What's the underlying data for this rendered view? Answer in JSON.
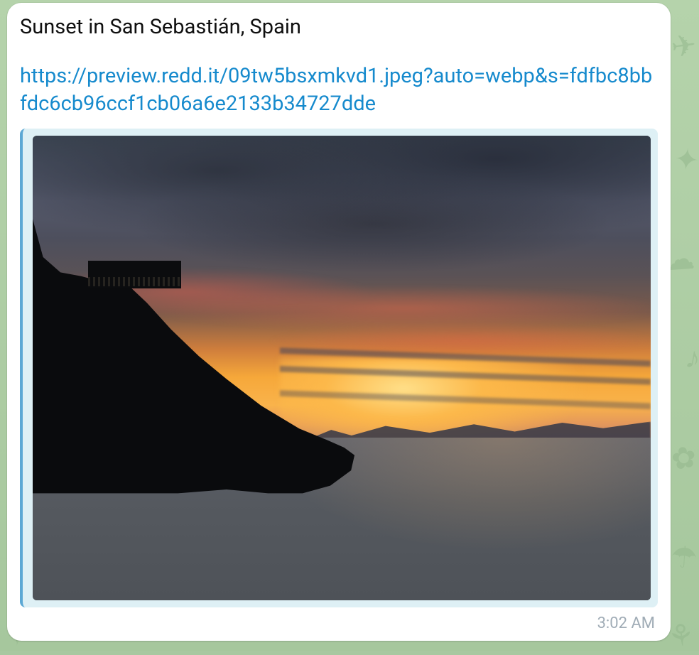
{
  "message": {
    "title": "Sunset in San Sebastián, Spain",
    "link_text": "https://preview.redd.it/09tw5bsxmkvd1.jpeg?auto=webp&s=fdfbc8bbfdc6cb96ccf1cb06a6e2133b34727dde",
    "timestamp": "3:02 AM"
  }
}
